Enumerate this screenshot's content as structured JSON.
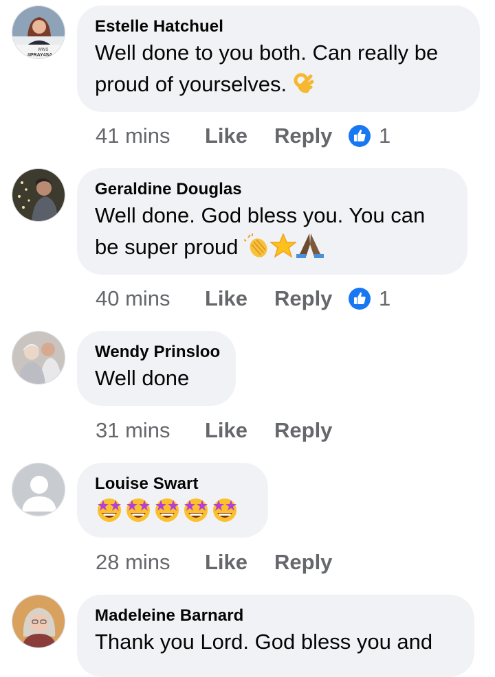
{
  "comments": [
    {
      "author": "Estelle Hatchuel",
      "line1": "Well done to you both. Can really be",
      "line2": "proud of yourselves.",
      "emojis": [
        "ok-hand"
      ],
      "avatar_text_top": "WWS",
      "avatar_text": "#PRAY4SA",
      "time": "41 mins",
      "like": "Like",
      "reply": "Reply",
      "reaction_count": "1"
    },
    {
      "author": "Geraldine Douglas",
      "line1": "Well done. God bless you. You can",
      "line2": "be super proud",
      "emojis": [
        "clapping-hands",
        "star",
        "folded-hands"
      ],
      "time": "40 mins",
      "like": "Like",
      "reply": "Reply",
      "reaction_count": "1"
    },
    {
      "author": "Wendy Prinsloo",
      "line1": "Well done",
      "time": "31 mins",
      "like": "Like",
      "reply": "Reply"
    },
    {
      "author": "Louise Swart",
      "emojis": [
        "star-struck",
        "star-struck",
        "star-struck",
        "star-struck",
        "star-struck"
      ],
      "time": "28 mins",
      "like": "Like",
      "reply": "Reply"
    },
    {
      "author": "Madeleine Barnard",
      "line1": "Thank you Lord. God bless you and"
    }
  ],
  "colors": {
    "bubble": "#f0f2f5",
    "meta_text": "#65676b",
    "like_blue": "#1877f2"
  }
}
